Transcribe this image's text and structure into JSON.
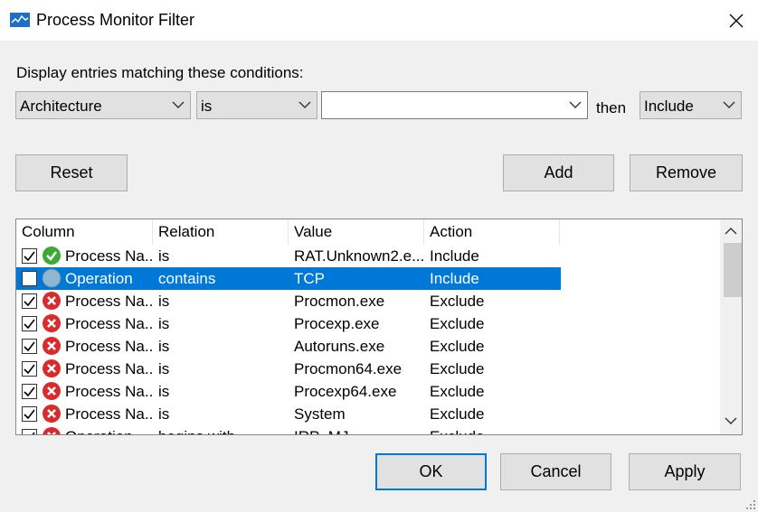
{
  "window": {
    "title": "Process Monitor Filter"
  },
  "filter": {
    "heading": "Display entries matching these conditions:",
    "column_select": "Architecture",
    "relation_select": "is",
    "value_input": "",
    "then_label": "then",
    "action_select": "Include"
  },
  "buttons": {
    "reset": "Reset",
    "add": "Add",
    "remove": "Remove",
    "ok": "OK",
    "cancel": "Cancel",
    "apply": "Apply"
  },
  "table": {
    "headers": [
      "Column",
      "Relation",
      "Value",
      "Action"
    ],
    "rows": [
      {
        "checked": true,
        "status": "include",
        "column": "Process Na...",
        "relation": "is",
        "value": "RAT.Unknown2.e...",
        "action": "Include"
      },
      {
        "checked": false,
        "status": "neutral",
        "column": "Operation",
        "relation": "contains",
        "value": "TCP",
        "action": "Include"
      },
      {
        "checked": true,
        "status": "exclude",
        "column": "Process Na...",
        "relation": "is",
        "value": "Procmon.exe",
        "action": "Exclude"
      },
      {
        "checked": true,
        "status": "exclude",
        "column": "Process Na...",
        "relation": "is",
        "value": "Procexp.exe",
        "action": "Exclude"
      },
      {
        "checked": true,
        "status": "exclude",
        "column": "Process Na...",
        "relation": "is",
        "value": "Autoruns.exe",
        "action": "Exclude"
      },
      {
        "checked": true,
        "status": "exclude",
        "column": "Process Na...",
        "relation": "is",
        "value": "Procmon64.exe",
        "action": "Exclude"
      },
      {
        "checked": true,
        "status": "exclude",
        "column": "Process Na...",
        "relation": "is",
        "value": "Procexp64.exe",
        "action": "Exclude"
      },
      {
        "checked": true,
        "status": "exclude",
        "column": "Process Na...",
        "relation": "is",
        "value": "System",
        "action": "Exclude"
      },
      {
        "checked": true,
        "status": "exclude",
        "column": "Operation",
        "relation": "begins with",
        "value": "IRP_MJ_",
        "action": "Exclude"
      }
    ]
  }
}
